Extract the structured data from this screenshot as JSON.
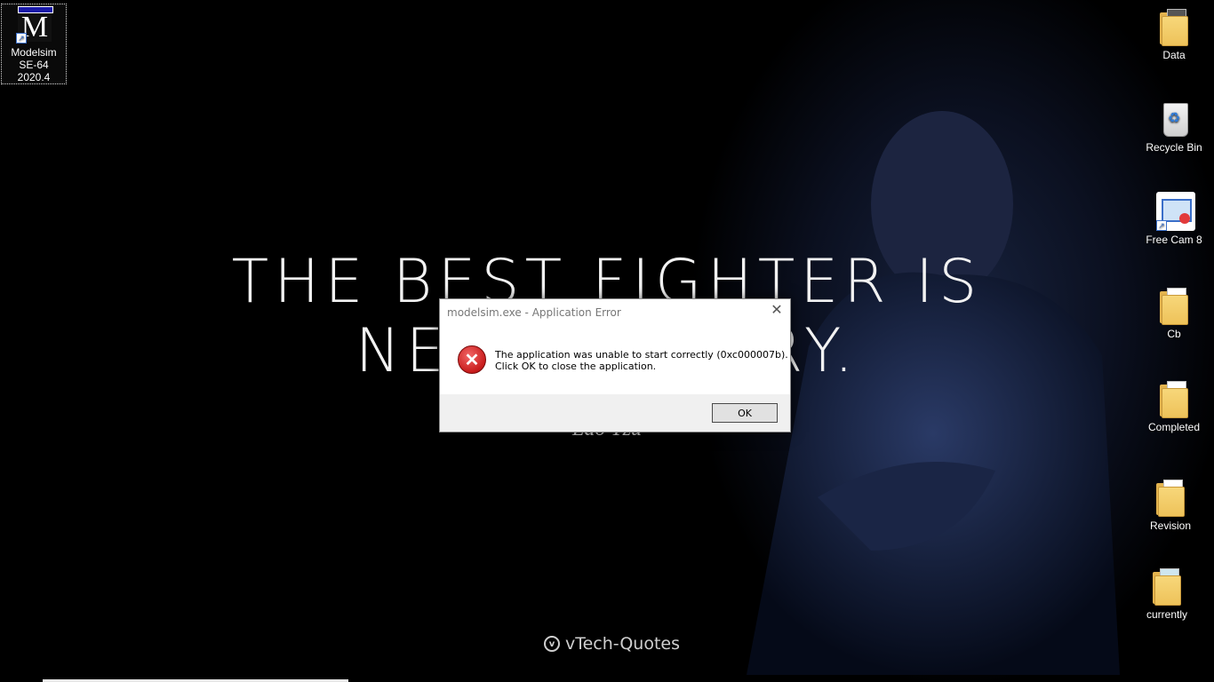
{
  "wallpaper": {
    "quote_line1": "THE BEST FIGHTER IS",
    "quote_line2": "NEVER ANGRY.",
    "author": "Lao Tzu",
    "brand": "vTech-Quotes"
  },
  "desktop_icons": {
    "modelsim": {
      "line1": "Modelsim",
      "line2": "SE-64 2020.4"
    },
    "data": {
      "label": "Data"
    },
    "recycle_bin": {
      "label": "Recycle Bin"
    },
    "free_cam": {
      "label": "Free Cam 8"
    },
    "cb": {
      "label": "Cb"
    },
    "completed": {
      "label": "Completed"
    },
    "revision": {
      "label": "Revision"
    },
    "currently": {
      "label": "currently"
    }
  },
  "dialog": {
    "title": "modelsim.exe - Application Error",
    "message_line1": "The application was unable to start correctly (0xc000007b).",
    "message_line2": "Click OK to close the application.",
    "ok_label": "OK",
    "close_glyph": "✕",
    "error_glyph": "✕"
  },
  "colors": {
    "error_red": "#c81c1c",
    "folder_yellow": "#eec25a"
  }
}
